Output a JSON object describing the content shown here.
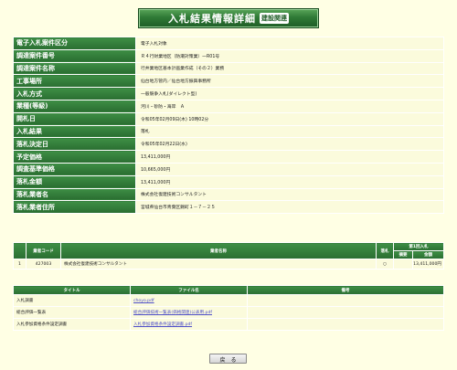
{
  "header": {
    "title": "入札結果情報詳細",
    "sub": "建設関連"
  },
  "details": [
    {
      "label": "電子入札案件区分",
      "value": "電子入札対象"
    },
    {
      "label": "調達案件番号",
      "value": "Ｒ４行財業地区（防潮対策業）一R01号"
    },
    {
      "label": "調達案件名称",
      "value": "行井業地区基本計画業作成（その２）業務"
    },
    {
      "label": "工事場所",
      "value": "仙台地方管内／仙台地方振興事務所"
    },
    {
      "label": "入札方式",
      "value": "一般競争入札(ダイレクト型)"
    },
    {
      "label": "業種(等級)",
      "value": "河川・砂防・海岸　Ａ"
    },
    {
      "label": "開札日",
      "value": "令和05年02月09日(木) 10時02分"
    },
    {
      "label": "入札結果",
      "value": "落札"
    },
    {
      "label": "落札決定日",
      "value": "令和05年02月22日(水)"
    },
    {
      "label": "予定価格",
      "value": "13,411,000円"
    },
    {
      "label": "調査基準価格",
      "value": "10,665,000円"
    },
    {
      "label": "落札金額",
      "value": "13,411,000円"
    },
    {
      "label": "落札業者名",
      "value": "株式会社復建技術コンサルタント"
    },
    {
      "label": "落札業者住所",
      "value": "宮城県仙台市青葉区錦町１－７－２５"
    }
  ],
  "result": {
    "headers": {
      "no": "",
      "code": "業者コード",
      "name": "業者名称",
      "award": "落札",
      "round": "第1回入札",
      "kind": "摘要",
      "amount": "金額"
    },
    "rows": [
      {
        "no": "1",
        "code": "427003",
        "name": "株式会社復建技術コンサルタント",
        "award": "○",
        "kind": "",
        "amount": "13,411,000円"
      }
    ]
  },
  "files": {
    "headers": {
      "title": "タイトル",
      "filename": "ファイル名",
      "remarks": "備考"
    },
    "rows": [
      {
        "title": "入札調書",
        "filename": "choyo.pdf",
        "remarks": ""
      },
      {
        "title": "総合評価一覧表",
        "filename": "総合評価技術一覧表(価格関連)公表用.pdf",
        "remarks": ""
      },
      {
        "title": "入札参加資格条件設定調書",
        "filename": "入札参加資格条件設定調書.pdf",
        "remarks": ""
      }
    ]
  },
  "back_button": "戻　る",
  "colors": {
    "header_green": "#2f7a36",
    "background": "#ffffe4",
    "link": "#5050c8"
  }
}
